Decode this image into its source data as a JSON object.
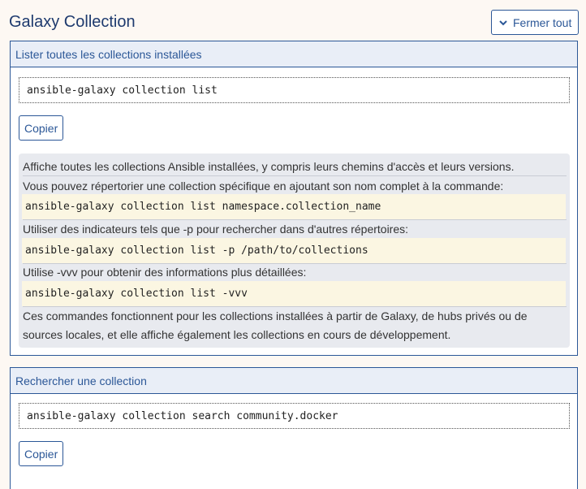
{
  "header": {
    "title": "Galaxy Collection",
    "collapse_label": "Fermer tout"
  },
  "sections": [
    {
      "title": "Lister toutes les collections installées",
      "command": "ansible-galaxy collection list",
      "copy_label": "Copier",
      "description": {
        "line1": "Affiche toutes les collections Ansible installées, y compris leurs chemins d'accès et leurs versions.",
        "line2": "Vous pouvez répertorier une collection spécifique en ajoutant son nom complet à la commande:",
        "code1": "ansible-galaxy collection list namespace.collection_name",
        "line3": "Utiliser des indicateurs tels que -p pour rechercher dans d'autres répertoires:",
        "code2": "ansible-galaxy collection list -p /path/to/collections",
        "line4": "Utilise -vvv pour obtenir des informations plus détaillées:",
        "code3": "ansible-galaxy collection list -vvv",
        "line5": "Ces commandes fonctionnent pour les collections installées à partir de Galaxy, de hubs privés ou de",
        "line6": "sources locales, et elle affiche également les collections en cours de développement."
      }
    },
    {
      "title": "Rechercher une collection",
      "command": "ansible-galaxy collection search community.docker",
      "copy_label": "Copier"
    }
  ]
}
